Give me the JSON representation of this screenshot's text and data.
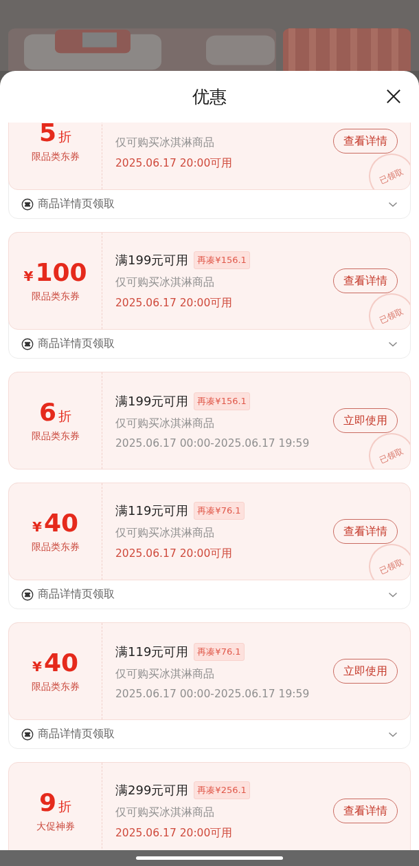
{
  "sheet": {
    "title": "优惠"
  },
  "coupons": [
    {
      "kind": "discount",
      "amount": "5",
      "unit": "折",
      "label": "限品类东券",
      "subtitle": "仅可购买冰淇淋商品",
      "date": "2025.06.17 20:00可用",
      "upcoming": true,
      "button": "查看详情",
      "stamp": "已领取",
      "footer": "商品详情页领取"
    },
    {
      "kind": "cash",
      "currency": "¥",
      "amount": "100",
      "label": "限品类东券",
      "condition": "满199元可用",
      "gap": "再凑¥156.1",
      "subtitle": "仅可购买冰淇淋商品",
      "date": "2025.06.17 20:00可用",
      "upcoming": true,
      "button": "查看详情",
      "stamp": "已领取",
      "footer": "商品详情页领取"
    },
    {
      "kind": "discount",
      "amount": "6",
      "unit": "折",
      "label": "限品类东券",
      "condition": "满199元可用",
      "gap": "再凑¥156.1",
      "subtitle": "仅可购买冰淇淋商品",
      "date": "2025.06.17 00:00-2025.06.17 19:59",
      "upcoming": false,
      "button": "立即使用",
      "stamp": "已领取"
    },
    {
      "kind": "cash",
      "currency": "¥",
      "amount": "40",
      "label": "限品类东券",
      "condition": "满119元可用",
      "gap": "再凑¥76.1",
      "subtitle": "仅可购买冰淇淋商品",
      "date": "2025.06.17 20:00可用",
      "upcoming": true,
      "button": "查看详情",
      "stamp": "已领取",
      "footer": "商品详情页领取"
    },
    {
      "kind": "cash",
      "currency": "¥",
      "amount": "40",
      "label": "限品类东券",
      "condition": "满119元可用",
      "gap": "再凑¥76.1",
      "subtitle": "仅可购买冰淇淋商品",
      "date": "2025.06.17 00:00-2025.06.17 19:59",
      "upcoming": false,
      "button": "立即使用",
      "footer": "商品详情页领取"
    },
    {
      "kind": "discount",
      "amount": "9",
      "unit": "折",
      "label": "大促神券",
      "condition": "满299元可用",
      "gap": "再凑¥256.1",
      "subtitle": "仅可购买冰淇淋商品",
      "date": "2025.06.17 20:00可用",
      "upcoming": true,
      "button": "查看详情"
    }
  ]
}
